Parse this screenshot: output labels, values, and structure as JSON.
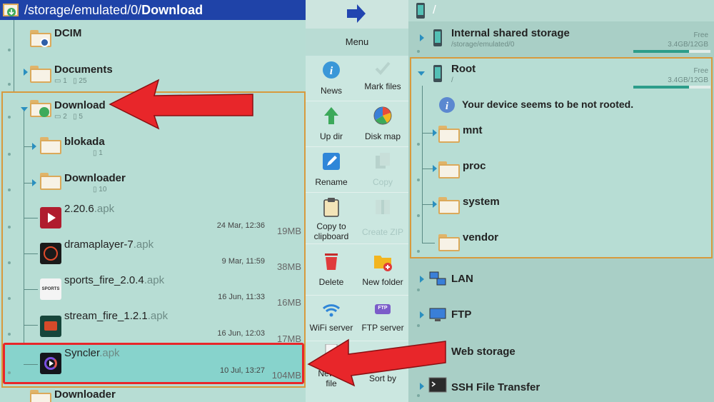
{
  "left": {
    "path_prefix": "/storage/emulated/0/",
    "path_current": "Download",
    "dcim": "DCIM",
    "documents": {
      "name": "Documents",
      "folders": "1",
      "files": "25"
    },
    "download": {
      "name": "Download",
      "folders": "2",
      "files": "5"
    },
    "blokada": {
      "name": "blokada",
      "files": "1"
    },
    "downloader": {
      "name": "Downloader",
      "files": "10"
    },
    "files": [
      {
        "name": "2.20.6",
        "ext": ".apk",
        "date": "24 Mar, 12:36",
        "size": "19MB"
      },
      {
        "name": "dramaplayer-7",
        "ext": ".apk",
        "date": "9 Mar, 11:59",
        "size": "38MB"
      },
      {
        "name": "sports_fire_2.0.4",
        "ext": ".apk",
        "date": "16 Jun, 11:33",
        "size": "16MB"
      },
      {
        "name": "stream_fire_1.2.1",
        "ext": ".apk",
        "date": "16 Jun, 12:03",
        "size": "17MB"
      },
      {
        "name": "Syncler",
        "ext": ".apk",
        "date": "10 Jul, 13:27",
        "size": "104MB"
      }
    ],
    "bottom_folder": "Downloader",
    "sports_icon_text": "SPORTS"
  },
  "menu": {
    "title": "Menu",
    "items": {
      "news": "News",
      "mark_files": "Mark files",
      "up_dir": "Up dir",
      "disk_map": "Disk map",
      "rename": "Rename",
      "copy": "Copy",
      "copy_clipboard_1": "Copy to",
      "copy_clipboard_2": "clipboard",
      "create_zip": "Create ZIP",
      "delete": "Delete",
      "new_folder": "New folder",
      "wifi_server": "WiFi server",
      "ftp_server": "FTP server",
      "new_text_1": "New te",
      "new_text_2": "file",
      "sort_by": "Sort by",
      "ftp_badge": "FTP"
    }
  },
  "right": {
    "header": "/",
    "internal": {
      "name": "Internal shared storage",
      "path": "/storage/emulated/0",
      "free_label": "Free",
      "usage": "3.4GB/12GB",
      "used_fraction": 0.72
    },
    "root": {
      "name": "Root",
      "path": "/",
      "free_label": "Free",
      "usage": "3.4GB/12GB",
      "used_fraction": 0.72
    },
    "not_rooted": "Your device seems to be not rooted.",
    "root_folders": [
      "mnt",
      "proc",
      "system",
      "vendor"
    ],
    "network": [
      "LAN",
      "FTP",
      "Web storage",
      "SSH File Transfer"
    ]
  },
  "colors": {
    "accent": "#1f43a8",
    "highlight_border": "#e8262a",
    "selected_bg": "#87d3cc",
    "group_border": "#d79a3d"
  }
}
